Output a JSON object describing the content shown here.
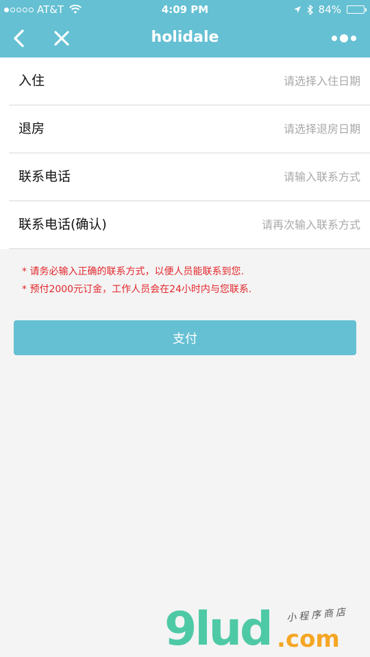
{
  "status_bar": {
    "carrier": "AT&T",
    "time": "4:09 PM",
    "battery": "84%",
    "battery_level": 0.84
  },
  "navbar": {
    "title": "holidale"
  },
  "form": {
    "rows": [
      {
        "label": "入住",
        "placeholder": "请选择入住日期"
      },
      {
        "label": "退房",
        "placeholder": "请选择退房日期"
      },
      {
        "label": "联系电话",
        "placeholder": "请输入联系方式"
      },
      {
        "label": "联系电话(确认)",
        "placeholder": "请再次输入联系方式"
      }
    ]
  },
  "notes": [
    "* 请务必输入正确的联系方式，以便人员能联系到您.",
    "* 预付2000元订金，工作人员会在24小时内与您联系."
  ],
  "pay_button": {
    "label": "支付"
  },
  "watermark": {
    "logo": "9lud",
    "domain": ".com",
    "tagline": "小程序商店"
  },
  "colors": {
    "accent": "#65c0d3",
    "note": "#e3262b"
  }
}
